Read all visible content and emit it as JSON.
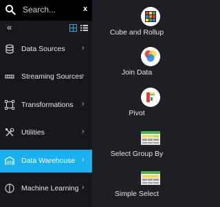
{
  "search": {
    "placeholder": "Search..."
  },
  "sidebar": {
    "items": [
      {
        "label": "Data Sources"
      },
      {
        "label": "Streaming Sources"
      },
      {
        "label": "Transformations"
      },
      {
        "label": "Utilities"
      },
      {
        "label": "Data Warehouse",
        "active": true
      },
      {
        "label": "Machine Learning"
      }
    ]
  },
  "tools": [
    {
      "label": "Cube and Rollup",
      "icon": "rubiks-cube-icon"
    },
    {
      "label": "Join Data",
      "icon": "venn-diagram-icon"
    },
    {
      "label": "Pivot",
      "icon": "pivot-icon"
    },
    {
      "label": "Select Group By",
      "icon": "table-group-icon"
    },
    {
      "label": "Simple Select",
      "icon": "table-select-icon"
    }
  ],
  "colors": {
    "accent": "#1ab2ee",
    "sidebar_bg": "#17181c",
    "panel_bg": "#1d1f24"
  }
}
